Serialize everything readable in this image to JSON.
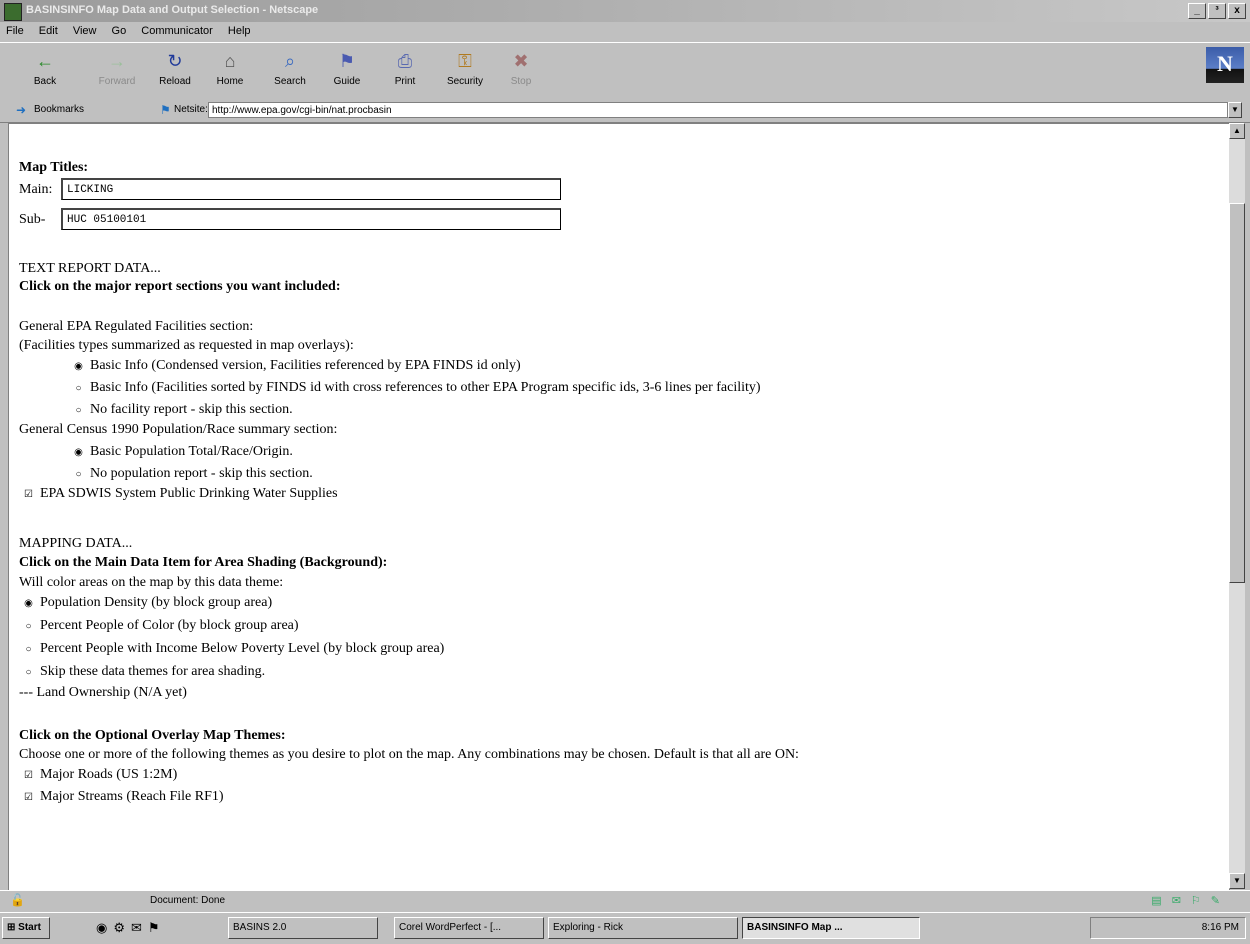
{
  "window": {
    "title": "BASINSINFO Map Data and Output Selection - Netscape",
    "controls": [
      "_",
      "³",
      "x"
    ]
  },
  "menu": [
    "File",
    "Edit",
    "View",
    "Go",
    "Communicator",
    "Help"
  ],
  "toolbar": [
    {
      "label": "Back",
      "icon": "back-arrow-icon",
      "glyph": "←",
      "enabled": true
    },
    {
      "label": "Forward",
      "icon": "forward-arrow-icon",
      "glyph": "→",
      "enabled": false
    },
    {
      "label": "Reload",
      "icon": "reload-icon",
      "glyph": "↻",
      "enabled": true
    },
    {
      "label": "Home",
      "icon": "home-icon",
      "glyph": "⌂",
      "enabled": true
    },
    {
      "label": "Search",
      "icon": "search-icon",
      "glyph": "⌕",
      "enabled": true
    },
    {
      "label": "Guide",
      "icon": "guide-icon",
      "glyph": "⚑",
      "enabled": true
    },
    {
      "label": "Print",
      "icon": "print-icon",
      "glyph": "⎙",
      "enabled": true
    },
    {
      "label": "Security",
      "icon": "lock-icon",
      "glyph": "⚿",
      "enabled": true
    },
    {
      "label": "Stop",
      "icon": "stop-icon",
      "glyph": "✖",
      "enabled": false
    }
  ],
  "location": {
    "bookmarks_label": "Bookmarks",
    "netsite_label": "Netsite:",
    "url": "http://www.epa.gov/cgi-bin/nat.procbasin"
  },
  "page": {
    "map_titles_heading": "Map Titles:",
    "main_label": "Main:",
    "main_value": "LICKING",
    "sub_label": "Sub-",
    "sub_value": "HUC 05100101",
    "text_report_heading": "TEXT REPORT DATA...",
    "text_report_instruction": "Click on the major report sections you want included:",
    "facilities_section": "General EPA Regulated Facilities section:",
    "facilities_note": "(Facilities types summarized as requested in map overlays):",
    "facility_options": [
      {
        "label": "Basic Info (Condensed version, Facilities referenced by EPA FINDS id only)",
        "checked": true
      },
      {
        "label": "Basic Info (Facilities sorted by FINDS id with cross references to other EPA Program specific ids, 3-6 lines per facility)",
        "checked": false
      },
      {
        "label": "No facility report - skip this section.",
        "checked": false
      }
    ],
    "census_section": "General Census 1990 Population/Race summary section:",
    "census_options": [
      {
        "label": "Basic Population Total/Race/Origin.",
        "checked": true
      },
      {
        "label": "No population report - skip this section.",
        "checked": false
      }
    ],
    "sdwis_label": "EPA SDWIS System Public Drinking Water Supplies",
    "sdwis_checked": true,
    "mapping_heading": "MAPPING DATA...",
    "mapping_instruction": "Click on the Main Data Item for Area Shading (Background):",
    "mapping_note": "Will color areas on the map by this data theme:",
    "shading_options": [
      {
        "label": "Population Density (by block group area)",
        "checked": true
      },
      {
        "label": "Percent People of Color (by block group area)",
        "checked": false
      },
      {
        "label": "Percent People with Income Below Poverty Level (by block group area)",
        "checked": false
      },
      {
        "label": "Skip these data themes for area shading.",
        "checked": false
      }
    ],
    "land_ownership": "--- Land Ownership (N/A yet)",
    "overlay_heading": "Click on the Optional Overlay Map Themes:",
    "overlay_note": "Choose one or more of the following themes as you desire to plot on the map. Any combinations may be chosen. Default is that all are ON:",
    "overlay_options": [
      {
        "label": "Major Roads (US 1:2M)",
        "checked": true
      },
      {
        "label": "Major Streams (Reach File RF1)",
        "checked": true
      }
    ]
  },
  "status": {
    "text": "Document: Done"
  },
  "taskbar": {
    "start": "Start",
    "tasks": [
      {
        "label": "BASINS 2.0",
        "active": false
      },
      {
        "label": "Corel WordPerfect - [...",
        "active": false
      },
      {
        "label": "Exploring - Rick",
        "active": false
      },
      {
        "label": "BASINSINFO Map ...",
        "active": true
      }
    ],
    "clock": "8:16 PM"
  }
}
